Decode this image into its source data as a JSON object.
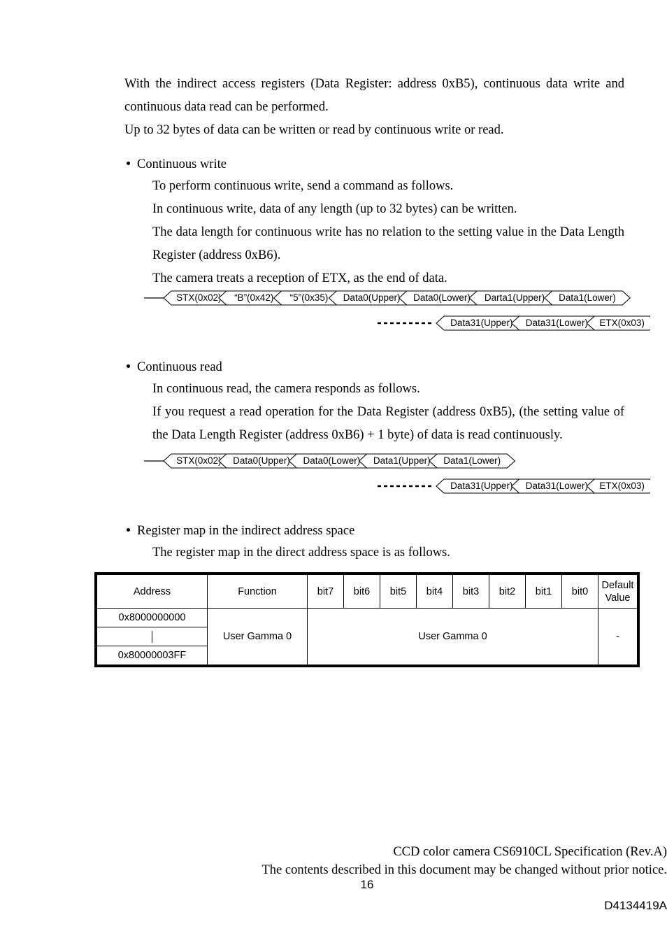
{
  "document": {
    "intro": {
      "line1": "With the indirect access registers (Data Register: address 0xB5), continuous data write and continuous data read can be performed.",
      "line2": "Up to 32 bytes of data can be written or read by continuous write or read."
    },
    "sections": {
      "continuous_write": {
        "heading": "Continuous write",
        "lines": [
          "To perform continuous write, send a command as follows.",
          "In continuous write, data of any length (up to 32 bytes) can be written.",
          "The data length for continuous write has no relation to the setting value in the Data Length Register (address 0xB6).",
          "The camera treats a reception of ETX, as the end of data."
        ]
      },
      "continuous_read": {
        "heading": "Continuous read",
        "lines": [
          "In continuous read, the camera responds as follows.",
          "If you request a read operation for the Data Register (address 0xB5), (the setting value of the Data Length Register (address 0xB6) + 1 byte) of data is read continuously."
        ]
      },
      "register_map": {
        "heading": "Register map in the indirect address space",
        "lines": [
          "The register map in the direct address space is as follows."
        ]
      }
    },
    "write_diagram": {
      "row1": [
        "STX(0x02)",
        "“B”(0x42)",
        "“5”(0x35)",
        "Data0(Upper)",
        "Data0(Lower)",
        "Darta1(Upper)",
        "Data1(Lower)"
      ],
      "row2": [
        "Data31(Upper)",
        "Data31(Lower)",
        "ETX(0x03)"
      ]
    },
    "read_diagram": {
      "row1": [
        "STX(0x02)",
        "Data0(Upper)",
        "Data0(Lower)",
        "Data1(Upper)",
        "Data1(Lower)"
      ],
      "row2": [
        "Data31(Upper)",
        "Data31(Lower)",
        "ETX(0x03)"
      ]
    },
    "register_table": {
      "headers": {
        "address": "Address",
        "function": "Function",
        "bits": [
          "bit7",
          "bit6",
          "bit5",
          "bit4",
          "bit3",
          "bit2",
          "bit1",
          "bit0"
        ],
        "default_line1": "Default",
        "default_line2": "Value"
      },
      "row": {
        "address_start": "0x8000000000",
        "address_end": "0x80000003FF",
        "function": "User Gamma 0",
        "bits_value": "User Gamma 0",
        "default_value": "-"
      }
    },
    "footer": {
      "spec": "CCD color camera CS6910CL Specification (Rev.A)",
      "notice": "The contents described in this document may be changed without prior notice.",
      "page_number": "16",
      "doc_code": "D4134419A"
    }
  }
}
